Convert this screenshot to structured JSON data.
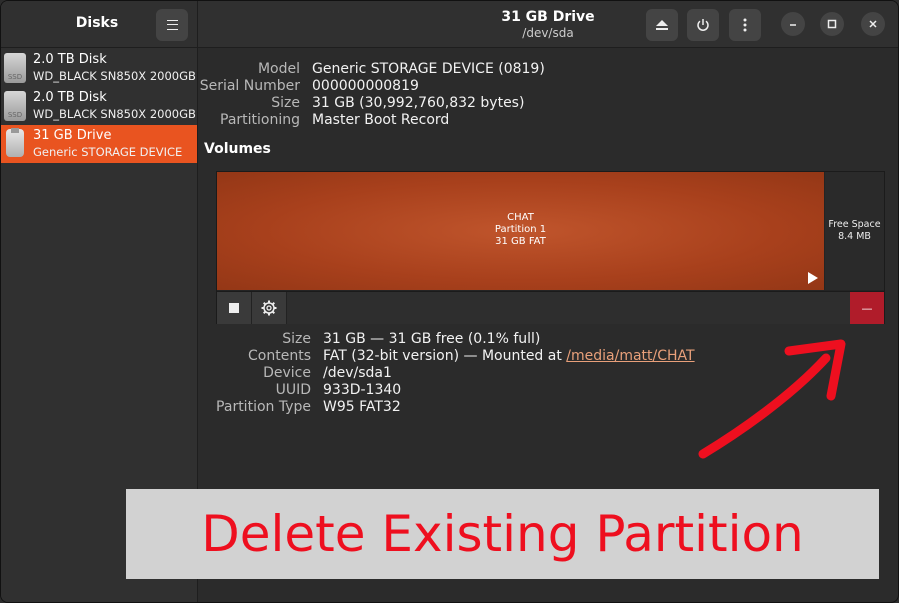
{
  "sidebar": {
    "title": "Disks",
    "menu_icon": "hamburger-icon",
    "disks": [
      {
        "name": "2.0 TB Disk",
        "model": "WD_BLACK SN850X 2000GB",
        "icon": "ssd-icon",
        "icon_text": "SSD"
      },
      {
        "name": "2.0 TB Disk",
        "model": "WD_BLACK SN850X 2000GB",
        "icon": "ssd-icon",
        "icon_text": "SSD"
      },
      {
        "name": "31 GB Drive",
        "model": "Generic STORAGE DEVICE",
        "icon": "usb-drive-icon",
        "selected": true
      }
    ]
  },
  "header": {
    "title": "31 GB Drive",
    "subtitle": "/dev/sda",
    "buttons": [
      "eject-icon",
      "power-icon",
      "more-vert-icon"
    ],
    "window_buttons": [
      "minimize-icon",
      "maximize-icon",
      "close-icon"
    ]
  },
  "drive": {
    "labels": {
      "model": "Model",
      "serial": "Serial Number",
      "size": "Size",
      "partitioning": "Partitioning"
    },
    "model": "Generic STORAGE DEVICE (0819)",
    "serial": "000000000819",
    "size": "31 GB (30,992,760,832 bytes)",
    "partitioning": "Master Boot Record"
  },
  "volumes": {
    "title": "Volumes",
    "partition": {
      "line1": "CHAT",
      "line2": "Partition 1",
      "line3": "31 GB FAT"
    },
    "free": {
      "line1": "Free Space",
      "line2": "8.4 MB"
    },
    "toolbar": [
      "stop-icon",
      "settings-gear-icon"
    ],
    "delete_label": "—"
  },
  "details": {
    "labels": {
      "size": "Size",
      "contents": "Contents",
      "device": "Device",
      "uuid": "UUID",
      "ptype": "Partition Type"
    },
    "size": "31 GB — 31 GB free (0.1% full)",
    "contents_prefix": "FAT (32-bit version) — Mounted at ",
    "contents_link": "/media/matt/CHAT",
    "device": "/dev/sda1",
    "uuid": "933D-1340",
    "ptype": "W95 FAT32"
  },
  "annotation": {
    "banner_text": "Delete Existing Partition",
    "arrow_color": "#ee0f1f"
  },
  "colors": {
    "accent": "#e95420",
    "danger": "#b01c2a"
  }
}
